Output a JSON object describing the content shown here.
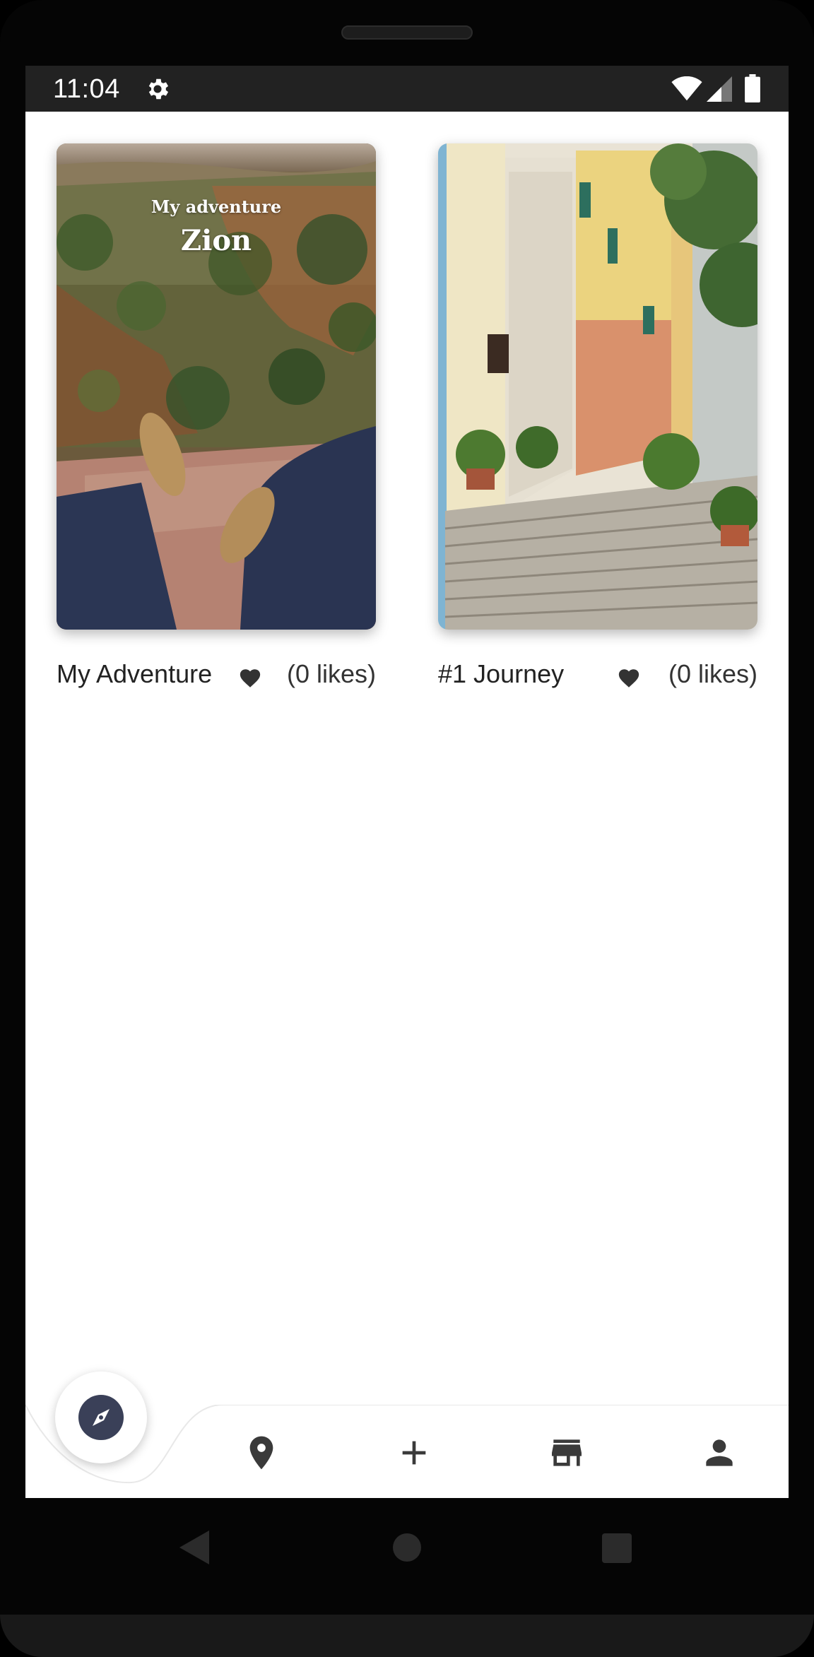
{
  "status_bar": {
    "time": "11:04",
    "icons": [
      "gear-icon",
      "wifi-icon",
      "cellular-signal-icon",
      "battery-icon"
    ]
  },
  "albums": [
    {
      "cover_subtitle": "My adventure",
      "cover_title": "Zion",
      "title": "My Adventure",
      "likes": "(0 likes)",
      "cover_image": "feet-over-canyon-photo"
    },
    {
      "title": "#1 Journey",
      "likes": "(0 likes)",
      "cover_image": "italian-stairway-street-photo"
    }
  ],
  "bottom_nav": {
    "items": [
      "compass-icon",
      "place-icon",
      "add-icon",
      "store-icon",
      "person-icon"
    ],
    "active": "compass-icon",
    "active_color": "#3a4058"
  },
  "system_nav": [
    "back-icon",
    "home-icon",
    "recents-icon"
  ]
}
